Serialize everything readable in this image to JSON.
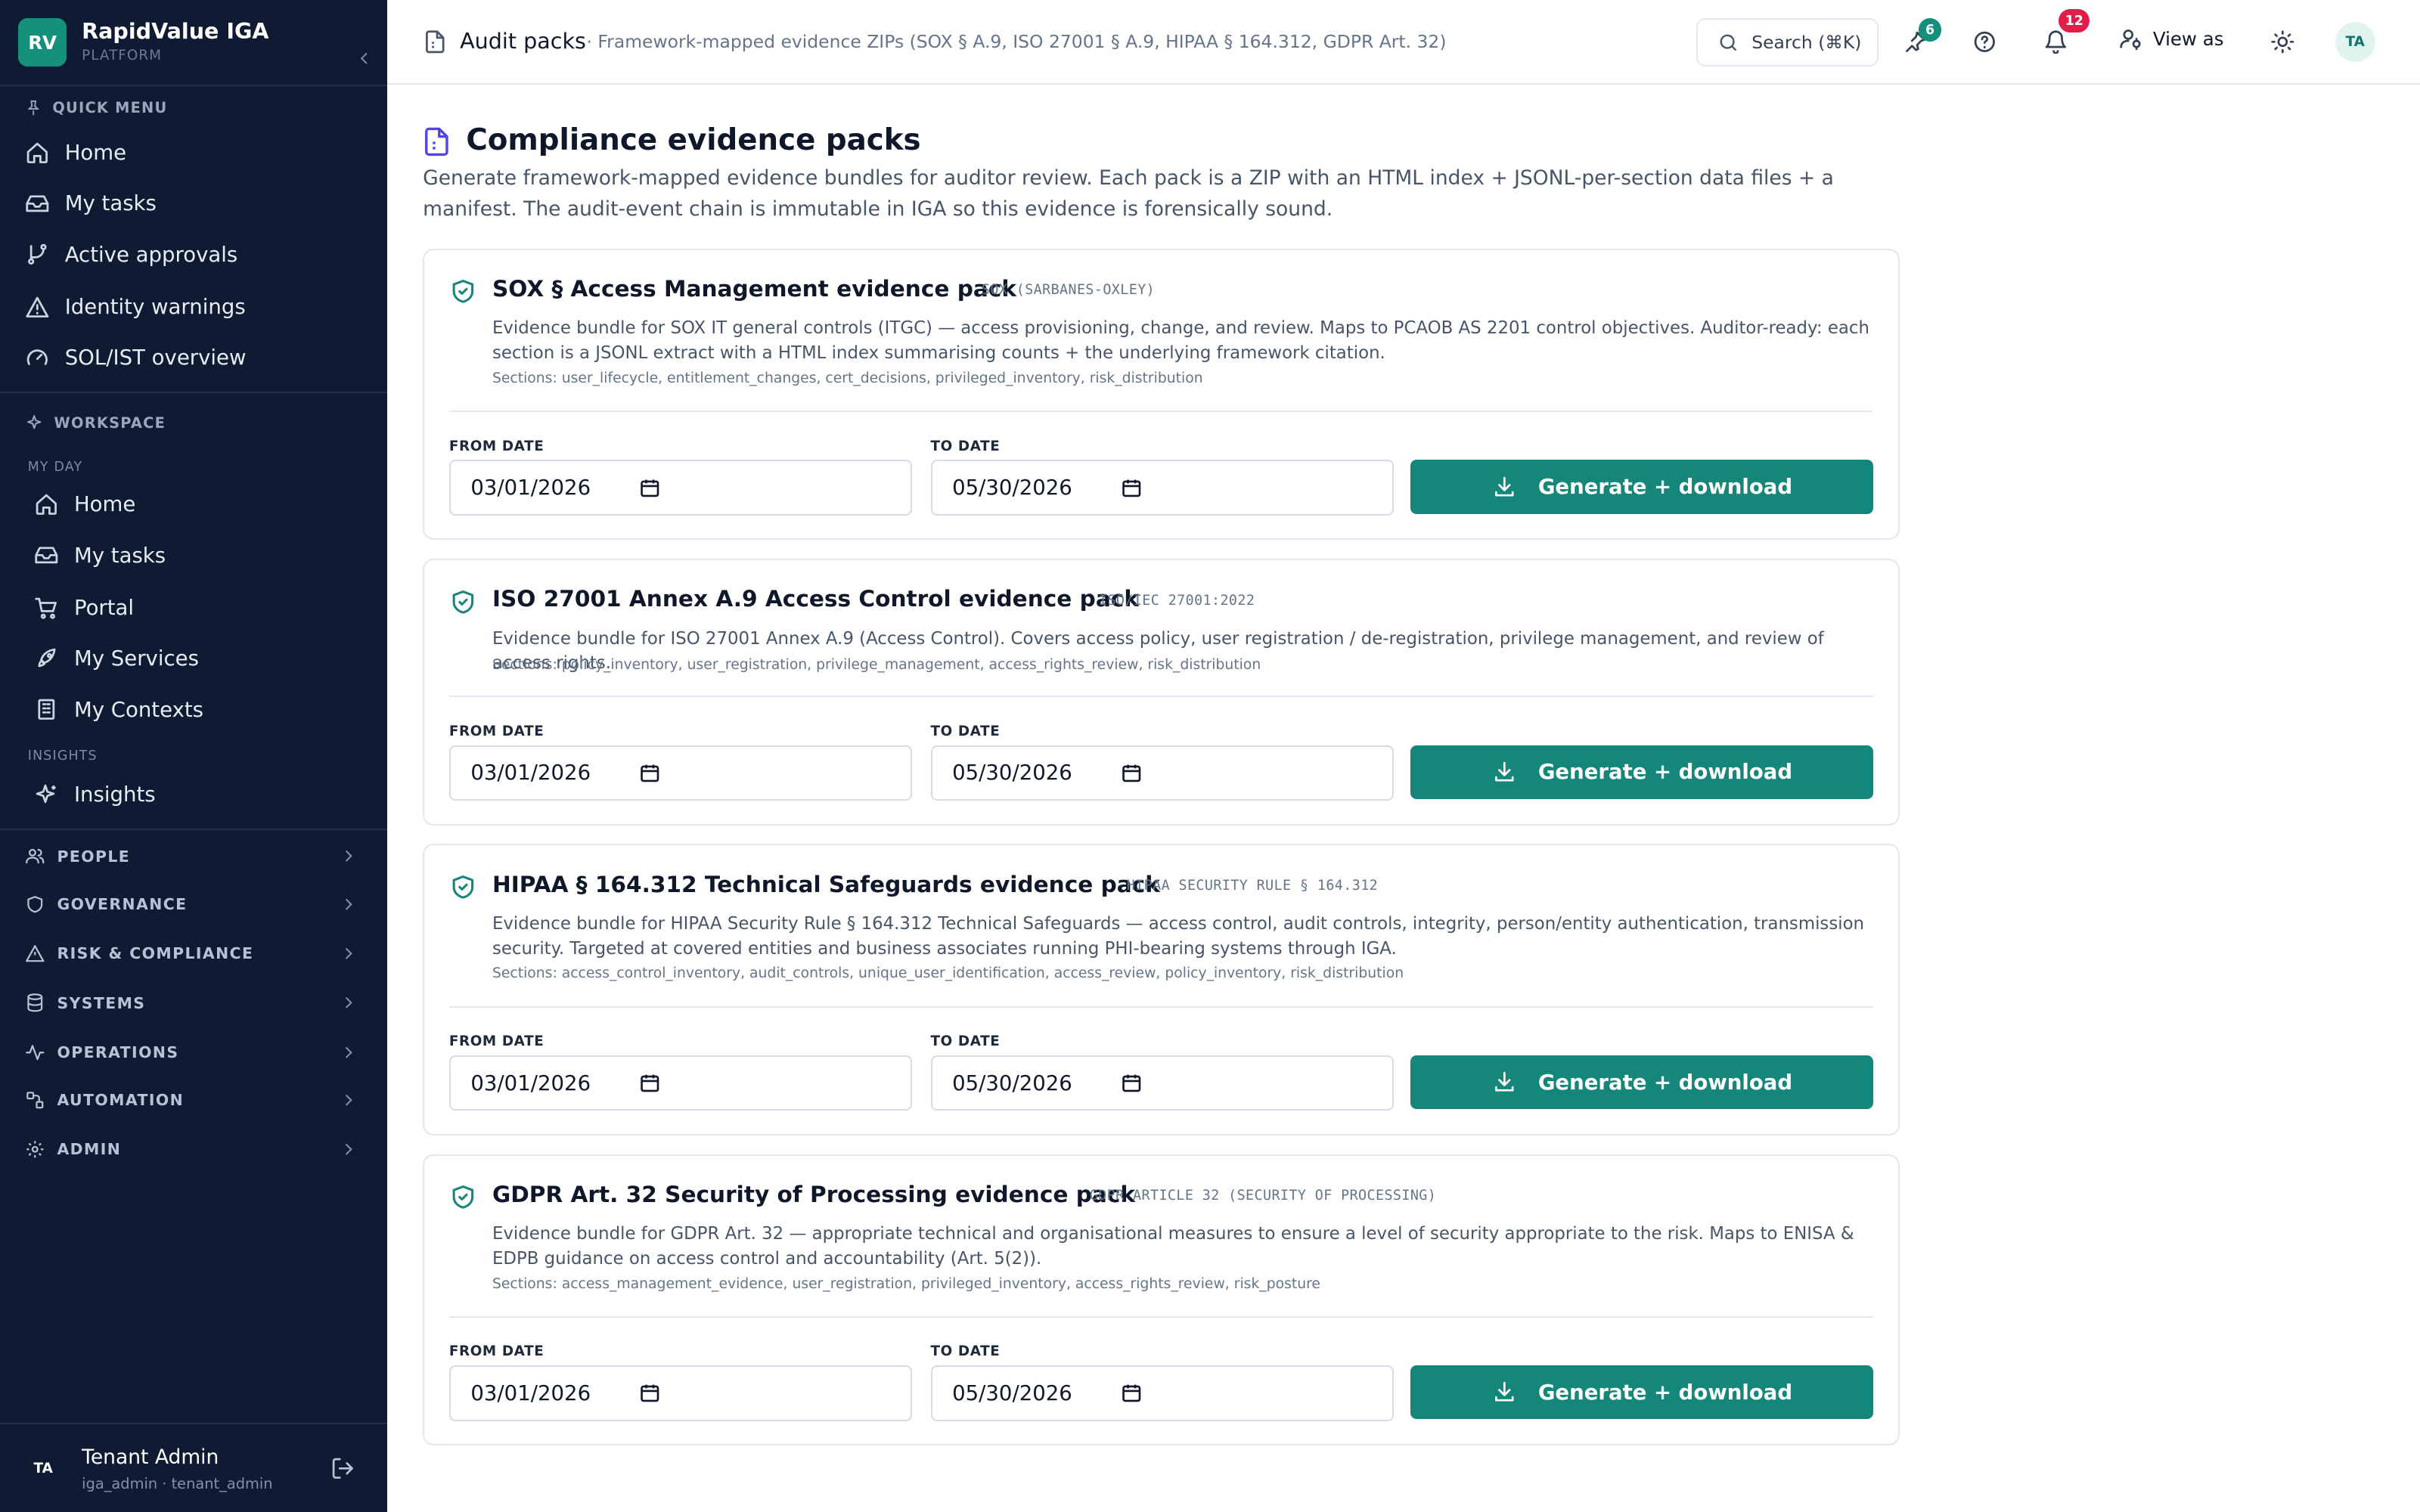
{
  "brand": {
    "logo": "RV",
    "name": "RapidValue IGA",
    "subtitle": "PLATFORM"
  },
  "sidebar": {
    "quick_menu_label": "QUICK MENU",
    "quick_menu": [
      {
        "label": "Home",
        "icon": "home-icon"
      },
      {
        "label": "My tasks",
        "icon": "inbox-icon"
      },
      {
        "label": "Active approvals",
        "icon": "branch-icon"
      },
      {
        "label": "Identity warnings",
        "icon": "warning-icon"
      },
      {
        "label": "SOL/IST overview",
        "icon": "gauge-icon"
      }
    ],
    "workspace_label": "WORKSPACE",
    "my_day_label": "MY DAY",
    "my_day": [
      {
        "label": "Home",
        "icon": "home-icon"
      },
      {
        "label": "My tasks",
        "icon": "inbox-icon"
      },
      {
        "label": "Portal",
        "icon": "cart-icon"
      },
      {
        "label": "My Services",
        "icon": "rocket-icon"
      },
      {
        "label": "My Contexts",
        "icon": "building-icon"
      }
    ],
    "insights_label": "INSIGHTS",
    "insights": [
      {
        "label": "Insights",
        "icon": "sparkle-icon"
      }
    ],
    "groups": [
      {
        "label": "PEOPLE",
        "icon": "people-icon"
      },
      {
        "label": "GOVERNANCE",
        "icon": "shield-icon"
      },
      {
        "label": "RISK & COMPLIANCE",
        "icon": "warning-icon"
      },
      {
        "label": "SYSTEMS",
        "icon": "database-icon"
      },
      {
        "label": "OPERATIONS",
        "icon": "pulse-icon"
      },
      {
        "label": "AUTOMATION",
        "icon": "workflow-icon"
      },
      {
        "label": "ADMIN",
        "icon": "gear-icon"
      }
    ],
    "user": {
      "initials": "TA",
      "name": "Tenant Admin",
      "role": "iga_admin · tenant_admin"
    }
  },
  "topbar": {
    "title": "Audit packs",
    "subtitle": "· Framework-mapped evidence ZIPs (SOX § A.9, ISO 27001 § A.9, HIPAA § 164.312, GDPR Art. 32)",
    "search_label": "Search (⌘K)",
    "pinned_count": "6",
    "notification_count": "12",
    "view_as_label": "View as",
    "avatar_initials": "TA"
  },
  "colors": {
    "accent": "#14877a",
    "sidebar_bg": "#0f1b33",
    "badge_green": "#14907c",
    "badge_red": "#e11d48"
  },
  "page": {
    "title": "Compliance evidence packs",
    "description": "Generate framework-mapped evidence bundles for auditor review. Each pack is a ZIP with an HTML index + JSONL-per-section data files + a manifest. The audit-event chain is immutable in IGA so this evidence is forensically sound."
  },
  "form_labels": {
    "from": "FROM DATE",
    "to": "TO DATE",
    "generate": "Generate + download"
  },
  "packs": [
    {
      "title": "SOX § Access Management evidence pack",
      "tag": "SOX (SARBANES-OXLEY)",
      "description": "Evidence bundle for SOX IT general controls (ITGC) — access provisioning, change, and review. Maps to PCAOB AS 2201 control objectives. Auditor-ready: each section is a JSONL extract with a HTML index summarising counts + the underlying framework citation.",
      "sections": "Sections: user_lifecycle, entitlement_changes, cert_decisions, privileged_inventory, risk_distribution",
      "from_date": "03/01/2026",
      "to_date": "05/30/2026"
    },
    {
      "title": "ISO 27001 Annex A.9 Access Control evidence pack",
      "tag": "ISO/IEC 27001:2022",
      "description": "Evidence bundle for ISO 27001 Annex A.9 (Access Control). Covers access policy, user registration / de-registration, privilege management, and review of access rights.",
      "sections": "Sections: policy_inventory, user_registration, privilege_management, access_rights_review, risk_distribution",
      "from_date": "03/01/2026",
      "to_date": "05/30/2026"
    },
    {
      "title": "HIPAA § 164.312 Technical Safeguards evidence pack",
      "tag": "HIPAA SECURITY RULE § 164.312",
      "description": "Evidence bundle for HIPAA Security Rule § 164.312 Technical Safeguards — access control, audit controls, integrity, person/entity authentication, transmission security. Targeted at covered entities and business associates running PHI-bearing systems through IGA.",
      "sections": "Sections: access_control_inventory, audit_controls, unique_user_identification, access_review, policy_inventory, risk_distribution",
      "from_date": "03/01/2026",
      "to_date": "05/30/2026"
    },
    {
      "title": "GDPR Art. 32 Security of Processing evidence pack",
      "tag": "GDPR ARTICLE 32 (SECURITY OF PROCESSING)",
      "description": "Evidence bundle for GDPR Art. 32 — appropriate technical and organisational measures to ensure a level of security appropriate to the risk. Maps to ENISA & EDPB guidance on access control and accountability (Art. 5(2)).",
      "sections": "Sections: access_management_evidence, user_registration, privileged_inventory, access_rights_review, risk_posture",
      "from_date": "03/01/2026",
      "to_date": "05/30/2026"
    }
  ]
}
